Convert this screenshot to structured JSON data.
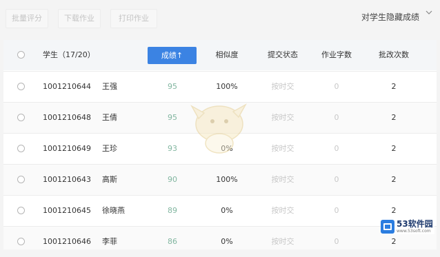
{
  "toolbar": {
    "batch_review": "批量评分",
    "download_homework": "下载作业",
    "print_homework": "打印作业",
    "hide_scores": "对学生隐藏成绩"
  },
  "table": {
    "headers": {
      "student": "学生（17/20）",
      "score": "成绩↑",
      "similarity": "相似度",
      "status": "提交状态",
      "word_count": "作业字数",
      "review_count": "批改次数"
    },
    "rows": [
      {
        "id": "1001210644",
        "name": "王强",
        "score": "95",
        "similarity": "100%",
        "status": "按时交",
        "word_count": "0",
        "review_count": "2"
      },
      {
        "id": "1001210648",
        "name": "王倩",
        "score": "95",
        "similarity": "",
        "status": "按时交",
        "word_count": "0",
        "review_count": "2"
      },
      {
        "id": "1001210649",
        "name": "王珍",
        "score": "93",
        "similarity": "0%",
        "status": "按时交",
        "word_count": "0",
        "review_count": "2"
      },
      {
        "id": "1001210643",
        "name": "高斯",
        "score": "90",
        "similarity": "100%",
        "status": "按时交",
        "word_count": "0",
        "review_count": "2"
      },
      {
        "id": "1001210645",
        "name": "徐晓燕",
        "score": "89",
        "similarity": "0%",
        "status": "按时交",
        "word_count": "0",
        "review_count": "2"
      },
      {
        "id": "1001210646",
        "name": "李菲",
        "score": "86",
        "similarity": "0%",
        "status": "按时交",
        "word_count": "0",
        "review_count": "2"
      }
    ]
  },
  "watermark": {
    "brand": "53软件园",
    "url": "www.53soft.com"
  },
  "colors": {
    "accent": "#3b83e3",
    "score_text": "#82b6a0",
    "muted_text": "#c8c8c8"
  }
}
